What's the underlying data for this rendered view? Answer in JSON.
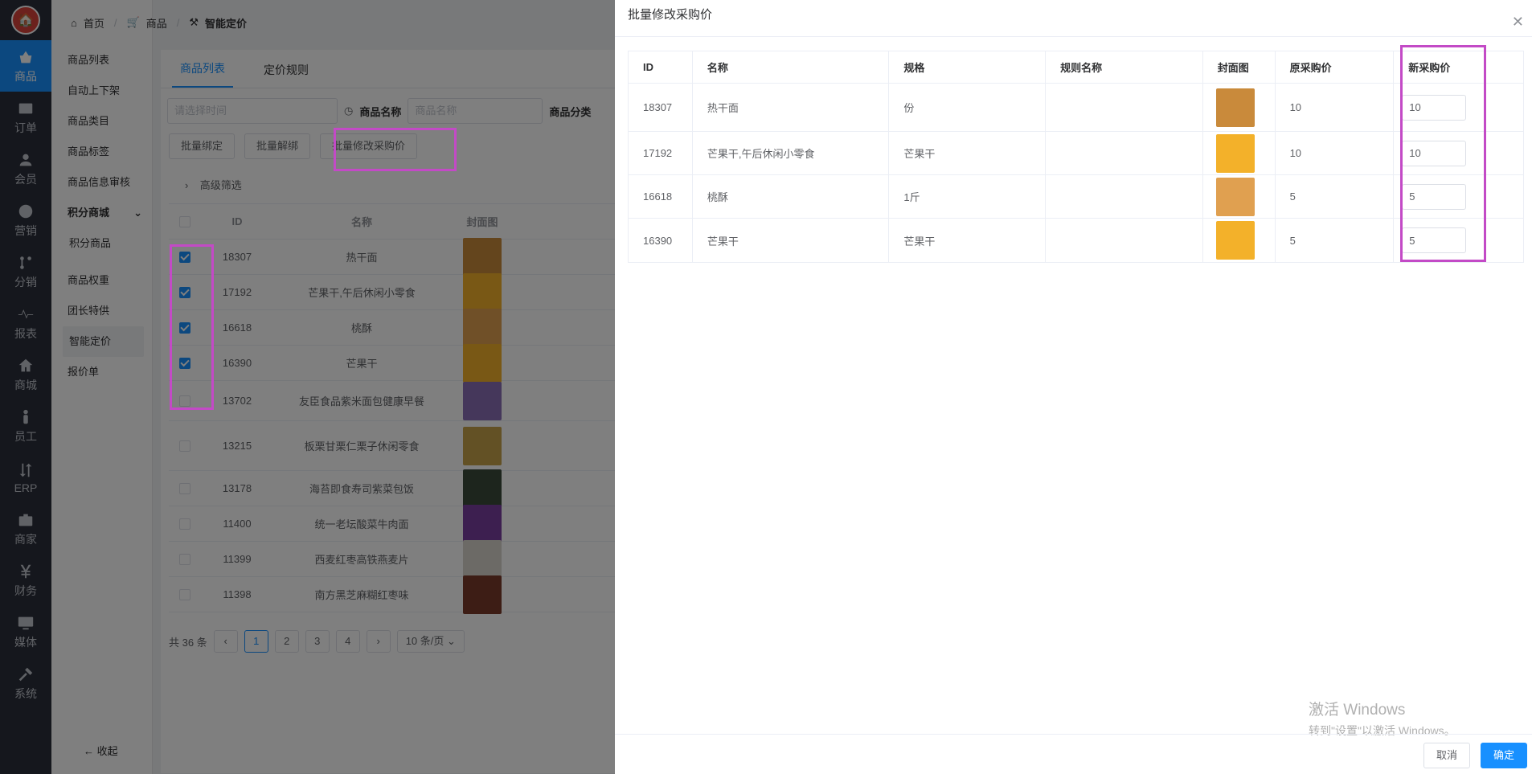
{
  "left_nav": [
    {
      "label": "商品",
      "icon": "basket-icon",
      "active": true
    },
    {
      "label": "订单",
      "icon": "order-icon"
    },
    {
      "label": "会员",
      "icon": "member-icon"
    },
    {
      "label": "营销",
      "icon": "palette-icon"
    },
    {
      "label": "分销",
      "icon": "branch-icon"
    },
    {
      "label": "报表",
      "icon": "pulse-icon"
    },
    {
      "label": "商城",
      "icon": "home-icon"
    },
    {
      "label": "员工",
      "icon": "person-icon"
    },
    {
      "label": "ERP",
      "icon": "erp-icon"
    },
    {
      "label": "商家",
      "icon": "briefcase-icon"
    },
    {
      "label": "财务",
      "icon": "yen-icon"
    },
    {
      "label": "媒体",
      "icon": "monitor-icon"
    },
    {
      "label": "系统",
      "icon": "tools-icon"
    }
  ],
  "side_menu": {
    "items": [
      "商品列表",
      "自动上下架",
      "商品类目",
      "商品标签",
      "商品信息审核"
    ],
    "group": "积分商城",
    "group_items": [
      "积分商品"
    ],
    "items2": [
      "商品权重",
      "团长特供",
      "智能定价",
      "报价单"
    ],
    "active": "智能定价",
    "collapse": "收起"
  },
  "breadcrumb": [
    "首页",
    "商品",
    "智能定价"
  ],
  "tabs": [
    "商品列表",
    "定价规则"
  ],
  "filters": {
    "date_placeholder": "请选择时间",
    "name_label": "商品名称",
    "name_placeholder": "商品名称",
    "category_label": "商品分类"
  },
  "buttons": [
    "批量绑定",
    "批量解绑",
    "批量修改采购价"
  ],
  "advanced_filter": "高级筛选",
  "list": {
    "headers": [
      "ID",
      "名称",
      "封面图"
    ],
    "rows": [
      {
        "id": "18307",
        "name": "热干面",
        "checked": true,
        "color": "#c98a3b"
      },
      {
        "id": "17192",
        "name": "芒果干,午后休闲小零食",
        "checked": true,
        "color": "#f3b12a"
      },
      {
        "id": "16618",
        "name": "桃酥",
        "checked": true,
        "color": "#e0a050"
      },
      {
        "id": "16390",
        "name": "芒果干",
        "checked": true,
        "color": "#f3b12a"
      },
      {
        "id": "13702",
        "name": "友臣食品紫米面包健康早餐",
        "checked": false,
        "color": "#8a6fb6"
      },
      {
        "id": "13215",
        "name": "板栗甘栗仁栗子休闲零食",
        "checked": false,
        "color": "#c7a24a"
      },
      {
        "id": "13178",
        "name": "海苔即食寿司紫菜包饭",
        "checked": false,
        "color": "#3b4a3a"
      },
      {
        "id": "11400",
        "name": "统一老坛酸菜牛肉面",
        "checked": false,
        "color": "#7b3fa0"
      },
      {
        "id": "11399",
        "name": "西麦红枣高铁燕麦片",
        "checked": false,
        "color": "#d9d4cc"
      },
      {
        "id": "11398",
        "name": "南方黑芝麻糊红枣味",
        "checked": false,
        "color": "#7a3a2a"
      }
    ]
  },
  "pagination": {
    "total": "共 36 条",
    "pages": [
      "1",
      "2",
      "3",
      "4"
    ],
    "active": "1",
    "size": "10 条/页"
  },
  "drawer": {
    "title": "批量修改采购价",
    "headers": [
      "ID",
      "名称",
      "规格",
      "规则名称",
      "封面图",
      "原采购价",
      "新采购价"
    ],
    "rows": [
      {
        "id": "18307",
        "name": "热干面",
        "spec": "份",
        "rule": "",
        "orig": "10",
        "new": "10",
        "color": "#c98a3b"
      },
      {
        "id": "17192",
        "name": "芒果干,午后休闲小零食",
        "spec": "芒果干",
        "rule": "",
        "orig": "10",
        "new": "10",
        "color": "#f3b12a"
      },
      {
        "id": "16618",
        "name": "桃酥",
        "spec": "1斤",
        "rule": "",
        "orig": "5",
        "new": "5",
        "color": "#e0a050"
      },
      {
        "id": "16390",
        "name": "芒果干",
        "spec": "芒果干",
        "rule": "",
        "orig": "5",
        "new": "5",
        "color": "#f3b12a"
      }
    ],
    "cancel": "取消",
    "confirm": "确定"
  },
  "watermark": {
    "line1": "激活 Windows",
    "line2": "转到\"设置\"以激活 Windows。"
  }
}
